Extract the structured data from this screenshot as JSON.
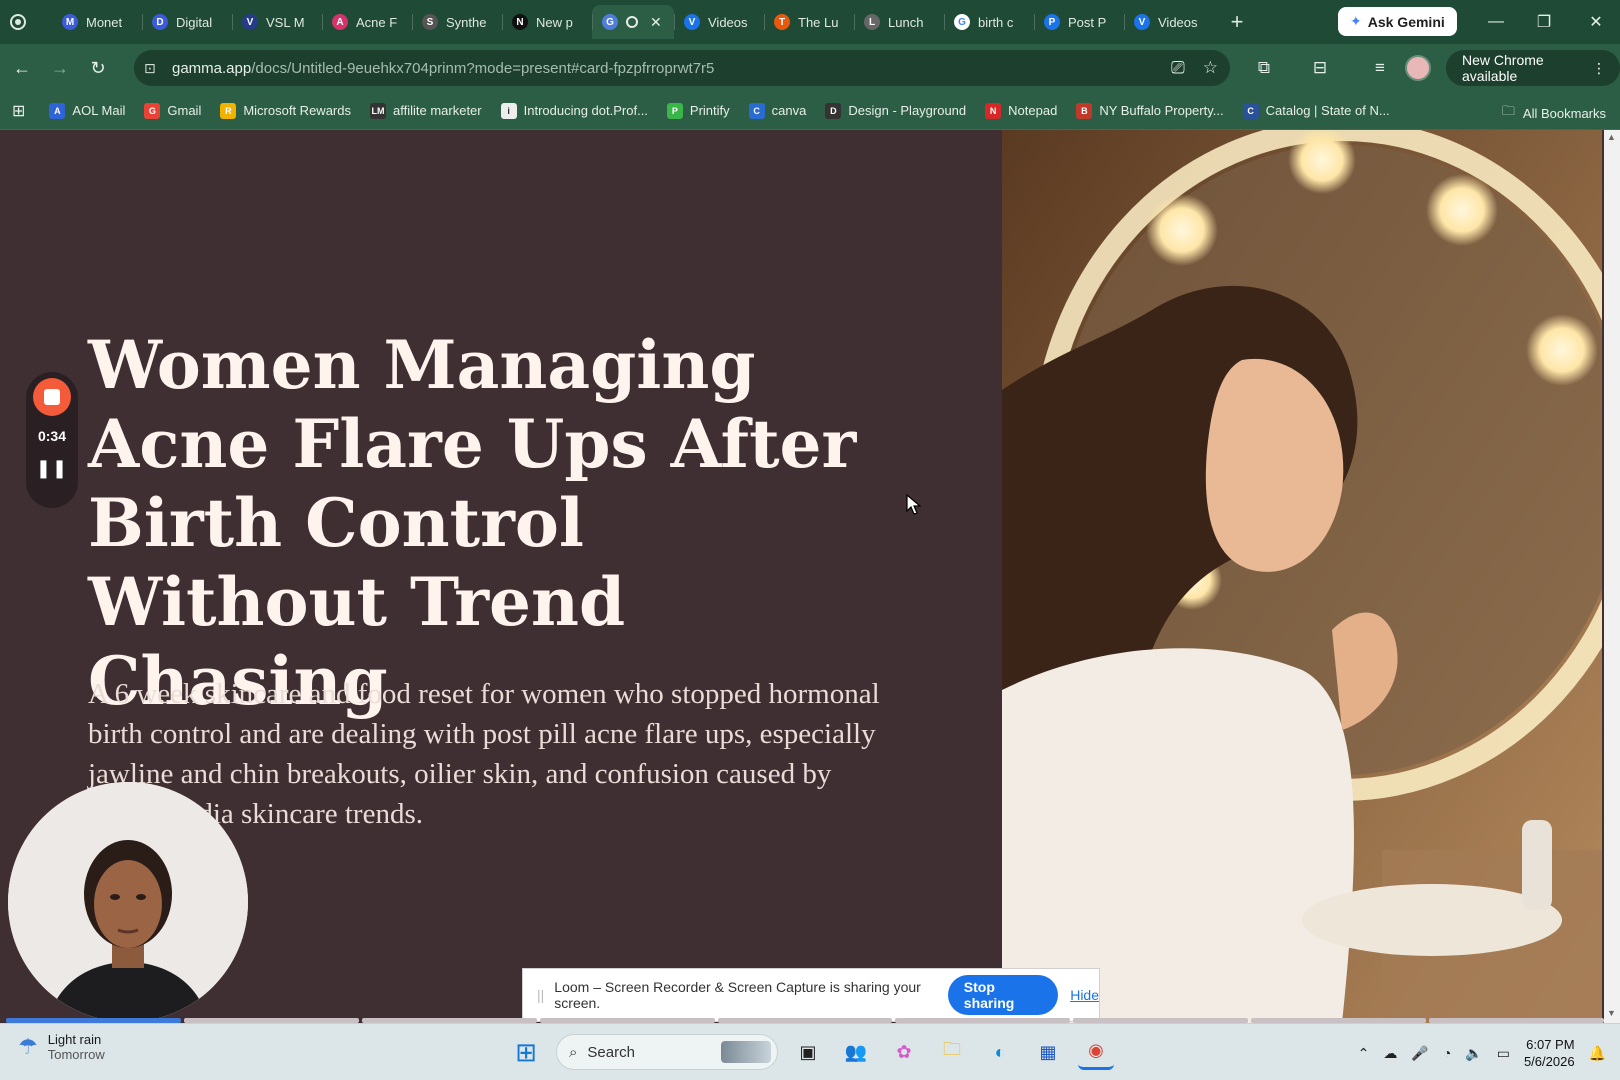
{
  "tabs": [
    {
      "title": "Monet",
      "color": "#3b5bdb",
      "glyph": "M"
    },
    {
      "title": "Digital",
      "color": "#3b5bdb",
      "glyph": "D"
    },
    {
      "title": "VSL M",
      "color": "#263b8a",
      "glyph": "V"
    },
    {
      "title": "Acne F",
      "color": "#d6336c",
      "glyph": "A"
    },
    {
      "title": "Synthe",
      "color": "#555555",
      "glyph": "S"
    },
    {
      "title": "New p",
      "color": "#111111",
      "glyph": "N"
    },
    {
      "title": "",
      "color": "#4f7ddc",
      "glyph": "G",
      "active": true
    },
    {
      "title": "Videos",
      "color": "#1a73e8",
      "glyph": "V"
    },
    {
      "title": "The Lu",
      "color": "#e8590c",
      "glyph": "T"
    },
    {
      "title": "Lunch",
      "color": "#666666",
      "glyph": "L"
    },
    {
      "title": "birth c",
      "color": "#ffffff",
      "glyph": "G"
    },
    {
      "title": "Post P",
      "color": "#1a73e8",
      "glyph": "P"
    },
    {
      "title": "Videos",
      "color": "#1a73e8",
      "glyph": "V"
    }
  ],
  "gemini_label": "Ask Gemini",
  "address": {
    "host": "gamma.app",
    "path": "/docs/Untitled-9euehkx704prinm?mode=present#card-fpzpfrroprwt7r5"
  },
  "new_chrome_label": "New Chrome available",
  "bookmarks": [
    {
      "label": "AOL Mail",
      "color": "#2f63d8",
      "glyph": "A"
    },
    {
      "label": "Gmail",
      "color": "#ea4335",
      "glyph": "G"
    },
    {
      "label": "Microsoft Rewards",
      "color": "#f2b200",
      "glyph": "R"
    },
    {
      "label": "affilite marketer",
      "color": "#333333",
      "glyph": "LM"
    },
    {
      "label": "Introducing dot.Prof...",
      "color": "#eeeeee",
      "glyph": "i"
    },
    {
      "label": "Printify",
      "color": "#39b54a",
      "glyph": "P"
    },
    {
      "label": "canva",
      "color": "#2a6bd1",
      "glyph": "C"
    },
    {
      "label": "Design - Playground",
      "color": "#333333",
      "glyph": "D"
    },
    {
      "label": "Notepad",
      "color": "#d62828",
      "glyph": "N"
    },
    {
      "label": "NY Buffalo Property...",
      "color": "#c0392b",
      "glyph": "B"
    },
    {
      "label": "Catalog | State of N...",
      "color": "#2a5298",
      "glyph": "C"
    }
  ],
  "all_bookmarks_label": "All Bookmarks",
  "slide": {
    "headline": "Women Managing Acne Flare Ups After Birth Control Without Trend Chasing",
    "subtext": "A 6 week skincare and food reset for women who stopped hormonal birth control and are dealing with post pill acne flare ups, especially jawline and chin breakouts, oilier skin, and confusion caused by social media skincare trends."
  },
  "loom": {
    "timer": "0:34",
    "share_message": "Loom – Screen Recorder & Screen Capture is sharing your screen.",
    "stop_label": "Stop sharing",
    "hide_label": "Hide"
  },
  "progress": {
    "segments": 9,
    "filled": 1
  },
  "taskbar": {
    "weather_line1": "Light rain",
    "weather_line2": "Tomorrow",
    "search_placeholder": "Search",
    "time": "6:07 PM",
    "date": "5/6/2026"
  }
}
